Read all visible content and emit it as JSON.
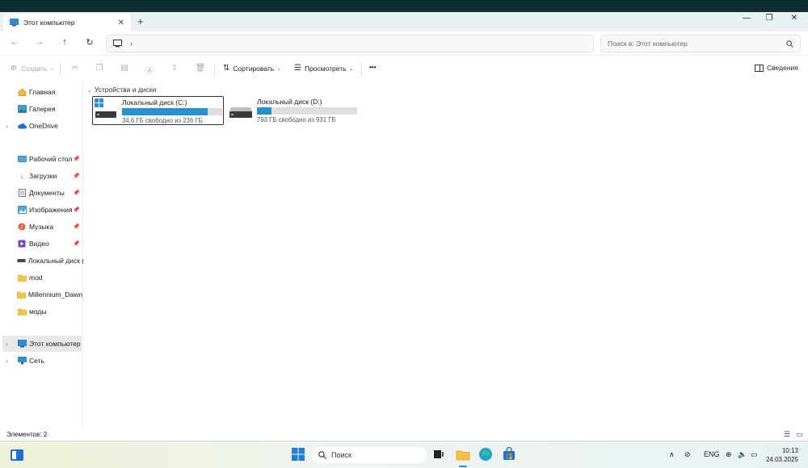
{
  "window": {
    "tab_title": "Этот компьютер",
    "new_tab": "+",
    "minimize": "—",
    "maximize": "❐",
    "close": "✕"
  },
  "nav": {
    "back": "←",
    "forward": "→",
    "up": "↑",
    "refresh": "↻",
    "address_chevron": "›",
    "search_placeholder": "Поиск в: Этот компьютер"
  },
  "toolbar": {
    "create": "Создать",
    "sort": "Сортировать",
    "view": "Просмотреть",
    "more": "•••",
    "details": "Сведения"
  },
  "sidebar": {
    "items": [
      {
        "label": "Главная",
        "icon": "home-icon"
      },
      {
        "label": "Галерея",
        "icon": "gallery-icon"
      },
      {
        "label": "OneDrive",
        "icon": "cloud-icon"
      },
      {
        "label": "Рабочий стол",
        "icon": "desktop-icon"
      },
      {
        "label": "Загрузки",
        "icon": "download-icon"
      },
      {
        "label": "Документы",
        "icon": "documents-icon"
      },
      {
        "label": "Изображения",
        "icon": "pictures-icon"
      },
      {
        "label": "Музыка",
        "icon": "music-icon"
      },
      {
        "label": "Видео",
        "icon": "video-icon"
      },
      {
        "label": "Локальный диск (D:)",
        "icon": "drive-icon"
      },
      {
        "label": "mod",
        "icon": "folder-icon"
      },
      {
        "label": "Millennium_Dawn_a",
        "icon": "folder-icon"
      },
      {
        "label": "моды",
        "icon": "folder-icon"
      },
      {
        "label": "Этот компьютер",
        "icon": "computer-icon"
      },
      {
        "label": "Сеть",
        "icon": "network-icon"
      }
    ]
  },
  "main": {
    "section_title": "Устройства и диски",
    "drives": [
      {
        "name": "Локальный диск (C:)",
        "free": "34,6 ГБ свободно из 236 ГБ",
        "used_fraction": 0.853
      },
      {
        "name": "Локальный диск (D:)",
        "free": "793 ГБ свободно из 931 ГБ",
        "used_fraction": 0.148
      }
    ]
  },
  "status": {
    "count": "Элементов: 2"
  },
  "taskbar": {
    "search": "Поиск",
    "lang": "ENG",
    "time": "10:13",
    "date": "24.03.2025"
  },
  "colors": {
    "accent": "#2691d1",
    "top_bar": "#0f2e33"
  }
}
